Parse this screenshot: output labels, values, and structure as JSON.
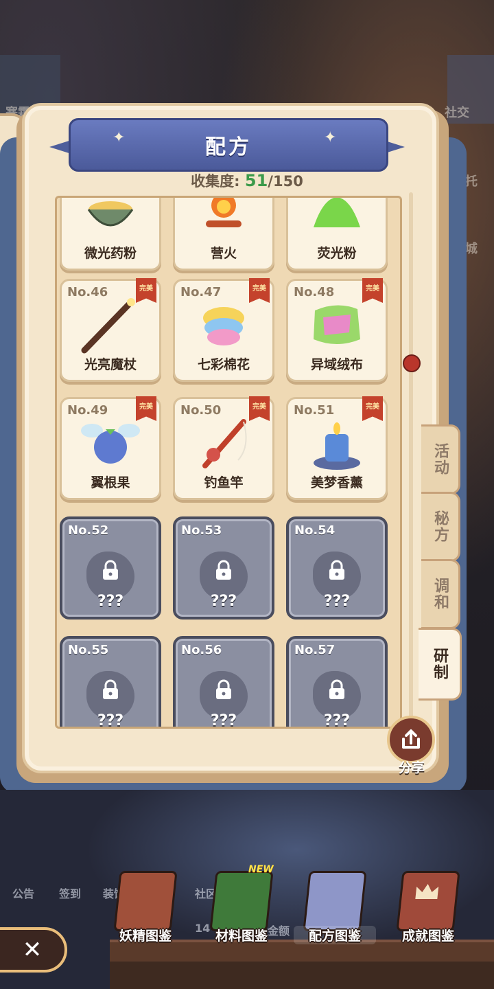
{
  "background": {
    "left_tag": "寒霜之",
    "social_label": "社交",
    "side_bits": [
      "托",
      "城"
    ]
  },
  "header": {
    "title": "配方",
    "collection_label": "收集度:",
    "collection_count": "51",
    "collection_total": "/150"
  },
  "recipes": [
    {
      "no": "",
      "name": "微光药粉",
      "state": "open",
      "perfect": false,
      "art": "powder-bowl"
    },
    {
      "no": "",
      "name": "营火",
      "state": "open",
      "perfect": false,
      "art": "campfire"
    },
    {
      "no": "",
      "name": "荧光粉",
      "state": "open",
      "perfect": false,
      "art": "glow-powder"
    },
    {
      "no": "No.46",
      "name": "光亮魔杖",
      "state": "open",
      "perfect": true,
      "art": "wand"
    },
    {
      "no": "No.47",
      "name": "七彩棉花",
      "state": "open",
      "perfect": true,
      "art": "cotton"
    },
    {
      "no": "No.48",
      "name": "异域绒布",
      "state": "open",
      "perfect": true,
      "art": "cloth"
    },
    {
      "no": "No.49",
      "name": "翼根果",
      "state": "open",
      "perfect": true,
      "art": "winged-fruit"
    },
    {
      "no": "No.50",
      "name": "钓鱼竿",
      "state": "open",
      "perfect": true,
      "art": "fishing-rod"
    },
    {
      "no": "No.51",
      "name": "美梦香薰",
      "state": "open",
      "perfect": true,
      "art": "candle"
    },
    {
      "no": "No.52",
      "name": "???",
      "state": "locked",
      "perfect": false
    },
    {
      "no": "No.53",
      "name": "???",
      "state": "locked",
      "perfect": false
    },
    {
      "no": "No.54",
      "name": "???",
      "state": "locked",
      "perfect": false
    },
    {
      "no": "No.55",
      "name": "???",
      "state": "locked",
      "perfect": false
    },
    {
      "no": "No.56",
      "name": "???",
      "state": "locked",
      "perfect": false
    },
    {
      "no": "No.57",
      "name": "???",
      "state": "locked",
      "perfect": false
    }
  ],
  "perfect_badge": "完美",
  "side_tabs": [
    {
      "label": "活动",
      "active": false
    },
    {
      "label": "秘方",
      "active": false
    },
    {
      "label": "调和",
      "active": false
    },
    {
      "label": "研制",
      "active": true
    }
  ],
  "share_label": "分享",
  "old_nav": [
    "公告",
    "签到",
    "装饰",
    "社区",
    "14",
    "金额"
  ],
  "bottom_tabs": [
    {
      "label": "妖精图鉴",
      "active": false,
      "new": false,
      "color": "#a0503a"
    },
    {
      "label": "材料图鉴",
      "active": false,
      "new": true,
      "color": "#3f7a3a"
    },
    {
      "label": "配方图鉴",
      "active": true,
      "new": false,
      "color": "#8e96c8"
    },
    {
      "label": "成就图鉴",
      "active": false,
      "new": false,
      "color": "#a04a3a"
    }
  ],
  "new_badge": "NEW",
  "close_label": "✕"
}
